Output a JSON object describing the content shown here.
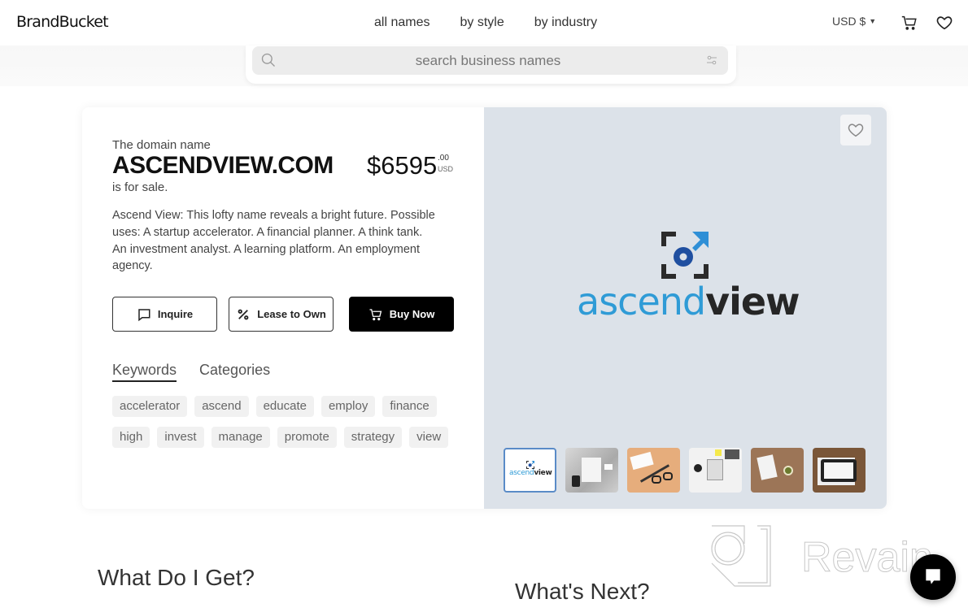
{
  "header": {
    "logo": "BrandBucket",
    "nav": [
      {
        "label": "all names"
      },
      {
        "label": "by style"
      },
      {
        "label": "by industry"
      }
    ],
    "currency": "USD $",
    "icons": [
      "cart-icon",
      "heart-icon"
    ]
  },
  "search": {
    "placeholder": "search business names",
    "value": ""
  },
  "listing": {
    "intro": "The domain name",
    "domain": "ASCENDVIEW.COM",
    "for_sale": "is for sale.",
    "price": {
      "amount": "$6595",
      "cents": ".00",
      "currency": "USD"
    },
    "description": "Ascend View: This lofty name reveals a bright future. Possible uses: A startup accelerator. A financial planner. A think tank. An investment analyst. A learning platform. An employment agency.",
    "buttons": {
      "inquire": "Inquire",
      "lease": "Lease to Own",
      "buy": "Buy Now"
    },
    "tabs": [
      {
        "label": "Keywords",
        "active": true
      },
      {
        "label": "Categories",
        "active": false
      }
    ],
    "keywords": [
      "accelerator",
      "ascend",
      "educate",
      "employ",
      "finance",
      "high",
      "invest",
      "manage",
      "promote",
      "strategy",
      "view"
    ]
  },
  "preview": {
    "logo_text_light": "ascend",
    "logo_text_bold": "view",
    "brand_colors": {
      "blue": "#2f9bd6",
      "dark": "#262626",
      "navy": "#1f4fa0"
    },
    "thumbnails": [
      {
        "label": "logo",
        "selected": true
      },
      {
        "label": "mockup-desk-gray",
        "selected": false
      },
      {
        "label": "mockup-card-glasses",
        "selected": false
      },
      {
        "label": "mockup-notebook",
        "selected": false
      },
      {
        "label": "mockup-paper-coffee",
        "selected": false
      },
      {
        "label": "mockup-tablet",
        "selected": false
      }
    ]
  },
  "sections": {
    "what_get": "What Do I Get?",
    "what_next": "What's Next?"
  },
  "watermark": "Revain"
}
